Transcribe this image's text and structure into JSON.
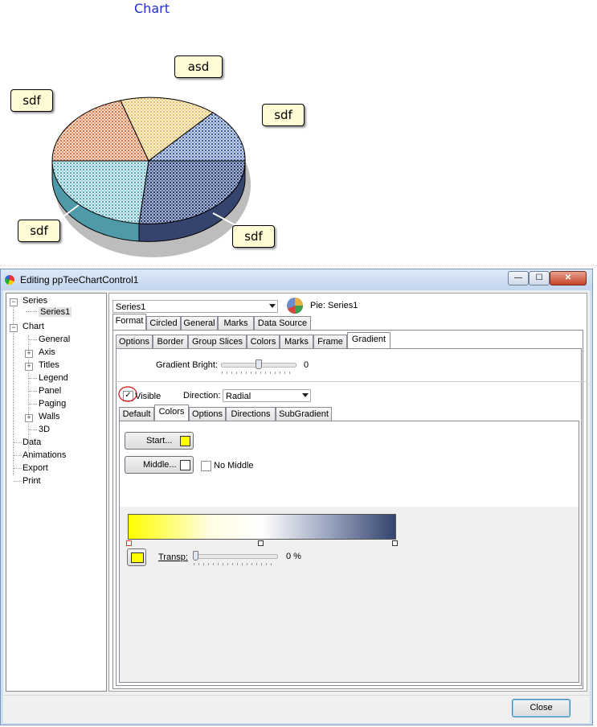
{
  "chart": {
    "title": "Chart",
    "marks": [
      "asd",
      "sdf",
      "sdf",
      "sdf",
      "sdf"
    ],
    "colors": {
      "yellow": "#ffff00",
      "navy": "#35446e",
      "teal": "#4e9aa9",
      "orange": "#d99066"
    }
  },
  "window": {
    "title": "Editing ppTeeChartControl1",
    "minimize": "—",
    "maximize": "☐",
    "close": "✕"
  },
  "tree": {
    "items": [
      "Series",
      "Series1",
      "Chart",
      "General",
      "Axis",
      "Titles",
      "Legend",
      "Panel",
      "Paging",
      "Walls",
      "3D",
      "Data",
      "Animations",
      "Export",
      "Print"
    ]
  },
  "series_selector": {
    "value": "Series1",
    "caption": "Pie: Series1"
  },
  "tabs_top": [
    "Format",
    "Circled",
    "General",
    "Marks",
    "Data Source"
  ],
  "tabs_format": [
    "Options",
    "Border",
    "Group Slices",
    "Colors",
    "Marks",
    "Frame",
    "Gradient"
  ],
  "gradient": {
    "bright_label": "Gradient Bright:",
    "bright_value": "0",
    "visible_label": "Visible",
    "visible_checked": "✓",
    "direction_label": "Direction:",
    "direction_value": "Radial"
  },
  "tabs_gradient": [
    "Default",
    "Colors",
    "Options",
    "Directions",
    "SubGradient"
  ],
  "colors_tab": {
    "start_label": "Start...",
    "middle_label": "Middle...",
    "no_middle_label": "No Middle",
    "transp_label": "Transp:",
    "transp_value": "0 %"
  },
  "footer": {
    "close_label": "Close"
  }
}
